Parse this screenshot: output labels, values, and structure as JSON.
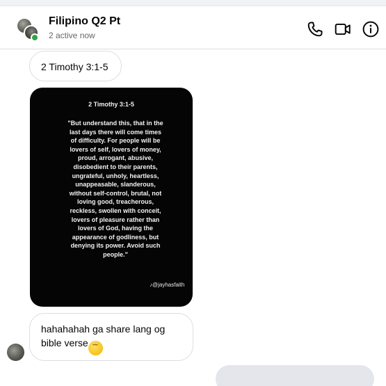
{
  "header": {
    "title": "Filipino Q2 Pt",
    "status": "2 active now",
    "icons": {
      "phone": "phone-icon",
      "video": "video-camera-icon",
      "info": "info-icon"
    }
  },
  "messages": {
    "first": {
      "text": "2 Timothy 3:1-5"
    },
    "image": {
      "title": "2 Timothy 3:1-5",
      "verse": "\"But understand this, that in the last days there will come times of difficulty. For people will be lovers of self, lovers of money, proud, arrogant, abusive, disobedient to their parents, ungrateful, unholy, heartless, unappeasable, slanderous, without self-control, brutal, not loving good, treacherous, reckless, swollen with conceit, lovers of pleasure rather than lovers of God, having the appearance of godliness, but denying its power. Avoid such people.\"",
      "watermark": "♪@jayhasfaith"
    },
    "third": {
      "text": "hahahahah ga share lang og bible verse",
      "emoji": "😅"
    }
  },
  "colors": {
    "online": "#31a24c",
    "bubble_border": "#dadde1",
    "outgoing_bubble": "#e4e6eb",
    "secondary_text": "#65676b"
  }
}
